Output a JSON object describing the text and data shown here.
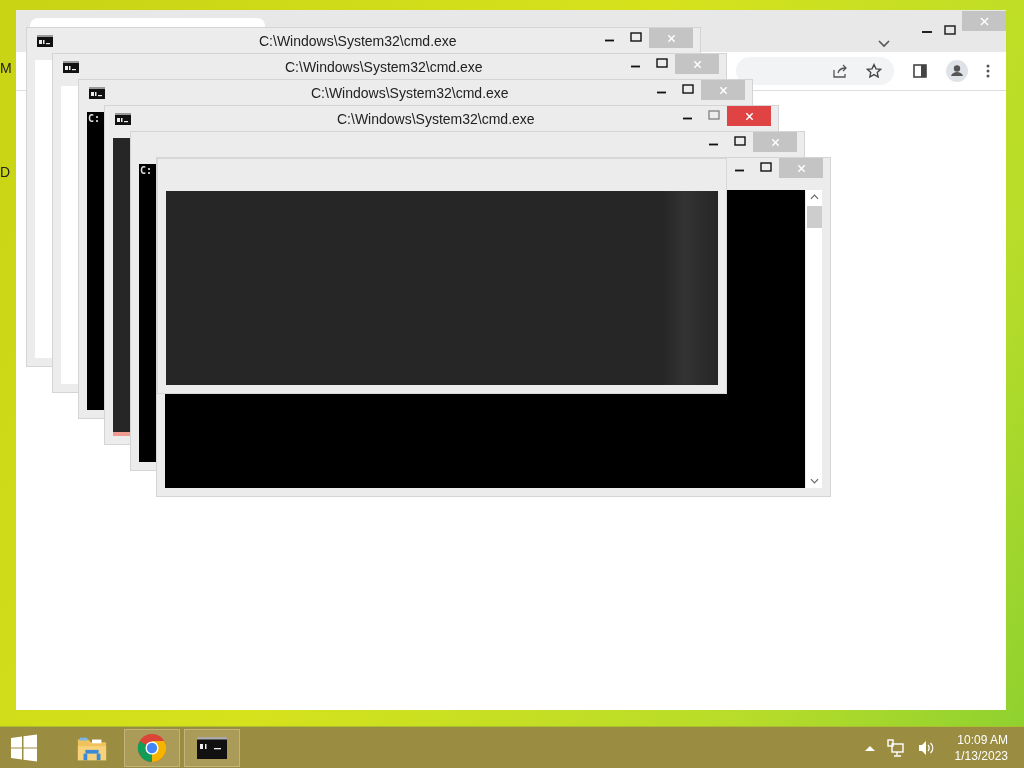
{
  "desktop_icons": [
    {
      "label": "M"
    },
    {
      "label": "D"
    }
  ],
  "cmd_windows": [
    {
      "title": "C:\\Windows\\System32\\cmd.exe",
      "active": false,
      "kind": "blank"
    },
    {
      "title": "C:\\Windows\\System32\\cmd.exe",
      "active": false,
      "kind": "blank"
    },
    {
      "title": "C:\\Windows\\System32\\cmd.exe",
      "active": false,
      "kind": "console",
      "console_text": "C:"
    },
    {
      "title": "C:\\Windows\\System32\\cmd.exe",
      "active": true,
      "kind": "dim"
    },
    {
      "active": false,
      "kind": "console",
      "console_text": "C:"
    },
    {
      "active": false,
      "kind": "trail"
    }
  ],
  "taskbar": {
    "apps": [
      {
        "kind": "explorer",
        "running": false
      },
      {
        "kind": "browser",
        "running": true
      },
      {
        "kind": "terminal",
        "running": true
      }
    ],
    "clock": {
      "time": "10:09 AM",
      "date": "1/13/2023"
    }
  }
}
